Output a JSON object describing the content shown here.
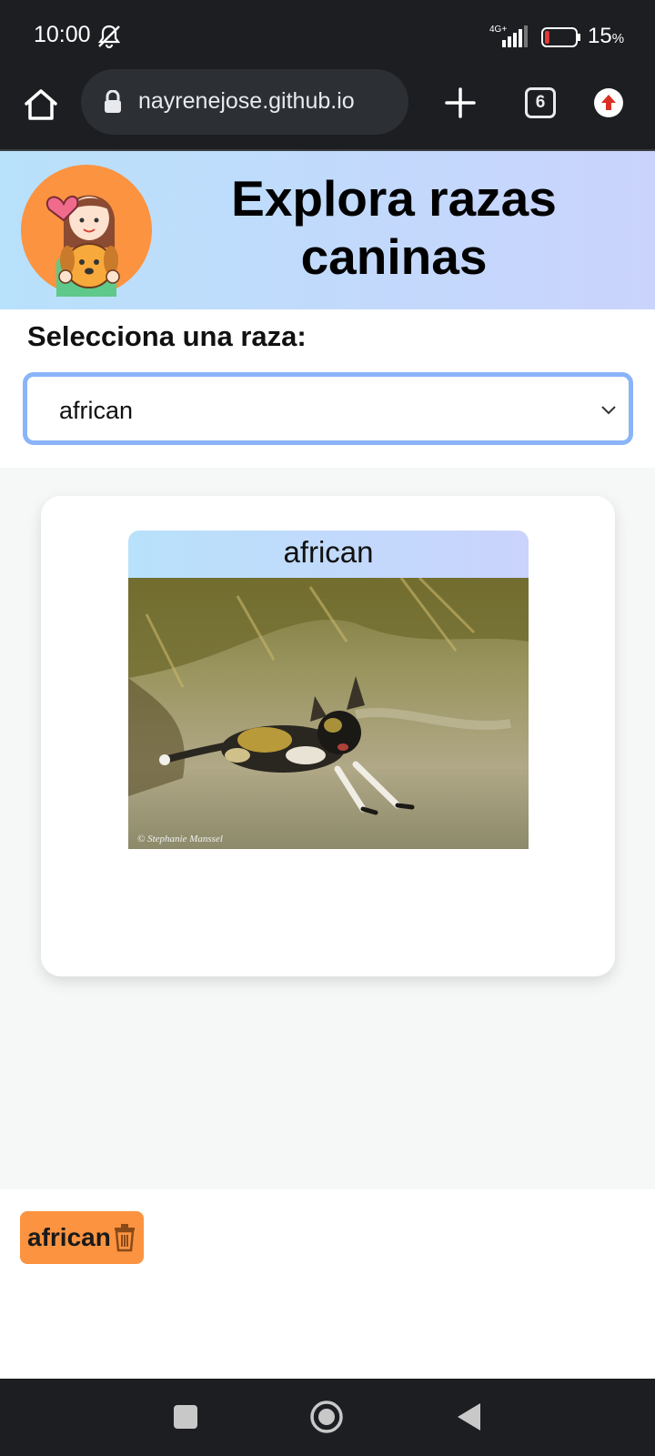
{
  "status_bar": {
    "time": "10:00",
    "network": "4G+",
    "battery_percent": "15",
    "battery_unit": "%",
    "battery_level": 0.15,
    "battery_color": "#e53935"
  },
  "browser": {
    "url": "nayrenejose.github.io",
    "tab_count": "6"
  },
  "header": {
    "title": "Explora razas caninas",
    "gradient_start": "#b8e1fb",
    "gradient_end": "#cad3fc",
    "logo_icon": "girl-with-dog-icon"
  },
  "selector": {
    "label": "Selecciona una raza:",
    "selected_value": "african",
    "border_color": "#8ab4f8"
  },
  "card": {
    "breed_name": "african",
    "image_icon": "african-wild-dog-photo",
    "watermark": "© Stephanie Manssel"
  },
  "favorites": {
    "items": [
      {
        "label": "african",
        "icon": "trash-icon"
      }
    ],
    "chip_color": "#fb9340"
  }
}
